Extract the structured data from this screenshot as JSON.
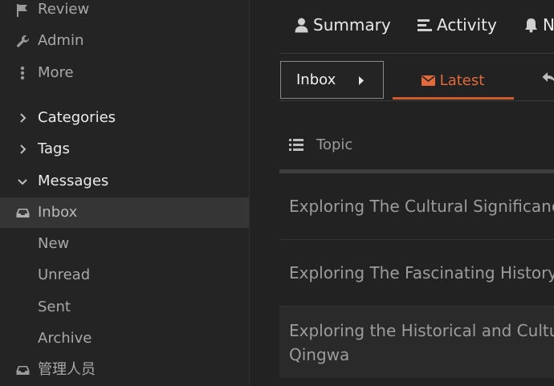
{
  "sidebar": {
    "items": [
      {
        "label": "Review",
        "icon": "flag-icon"
      },
      {
        "label": "Admin",
        "icon": "wrench-icon"
      },
      {
        "label": "More",
        "icon": "ellipsis-vertical-icon"
      },
      {
        "label": "Categories",
        "icon": "chevron-right-icon"
      },
      {
        "label": "Tags",
        "icon": "chevron-right-icon"
      },
      {
        "label": "Messages",
        "icon": "chevron-down-icon"
      },
      {
        "label": "Inbox",
        "icon": "inbox-icon"
      },
      {
        "label": "New"
      },
      {
        "label": "Unread"
      },
      {
        "label": "Sent"
      },
      {
        "label": "Archive"
      },
      {
        "label": "管理人员",
        "icon": "inbox-icon"
      }
    ]
  },
  "top_nav": {
    "summary": "Summary",
    "activity": "Activity",
    "notifications_partial": "N"
  },
  "tabs": {
    "inbox": "Inbox",
    "latest": "Latest"
  },
  "list": {
    "column_header": "Topic",
    "topics": [
      {
        "line1": "Exploring The Cultural Significanc"
      },
      {
        "line1": "Exploring The Fascinating History"
      },
      {
        "line1": "Exploring the Historical and Cultu",
        "line2": "Qingwa"
      }
    ]
  },
  "colors": {
    "accent": "#e06a3c",
    "background": "#222222",
    "sidebar_active": "#353535"
  }
}
